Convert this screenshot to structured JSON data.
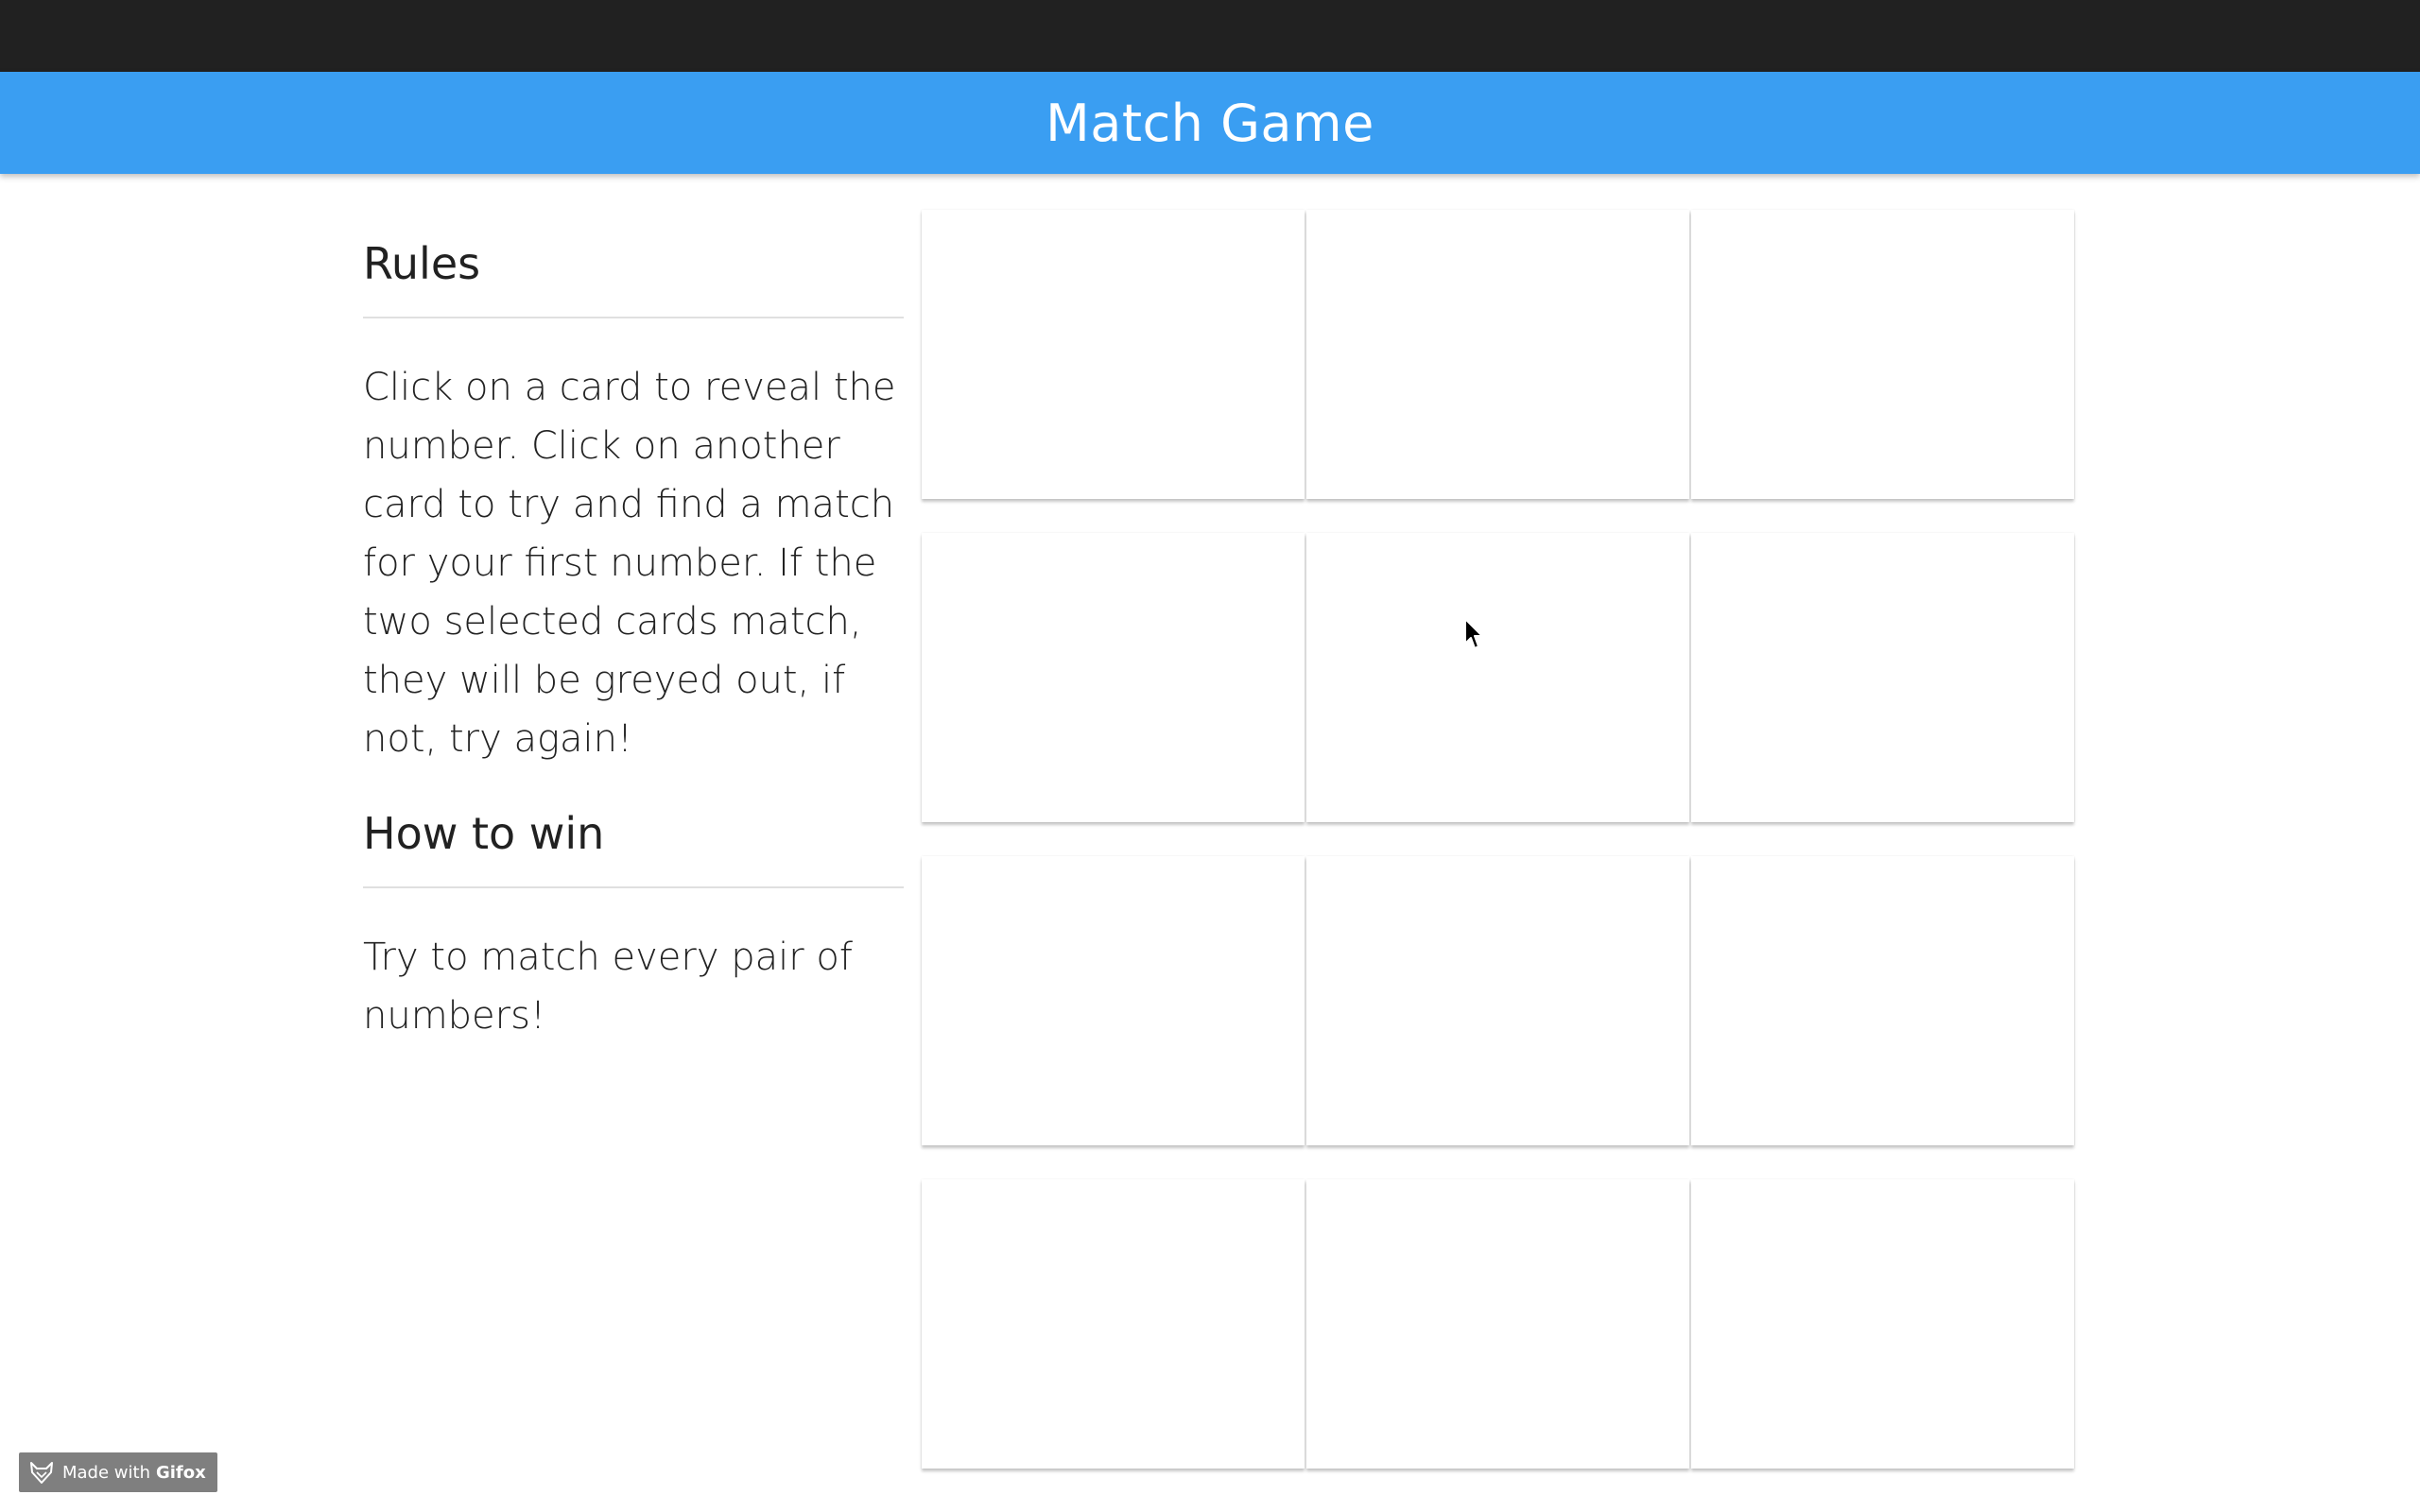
{
  "header": {
    "title": "Match Game",
    "color": "#3a9ef2"
  },
  "rules": {
    "heading": "Rules",
    "text": "Click on a card to reveal the number. Click on another card to try and find a match for your first number. If the two selected cards match, they will be greyed out, if not, try again!"
  },
  "how_to_win": {
    "heading": "How to win",
    "text": "Try to match every pair of numbers!"
  },
  "board": {
    "rows": 4,
    "columns": 3,
    "cards": [
      {
        "value": ""
      },
      {
        "value": ""
      },
      {
        "value": ""
      },
      {
        "value": ""
      },
      {
        "value": ""
      },
      {
        "value": ""
      },
      {
        "value": ""
      },
      {
        "value": ""
      },
      {
        "value": ""
      },
      {
        "value": ""
      },
      {
        "value": ""
      },
      {
        "value": ""
      }
    ]
  },
  "watermark": {
    "prefix": "Made with",
    "brand": "Gifox",
    "icon": "gifox-fox-icon"
  }
}
